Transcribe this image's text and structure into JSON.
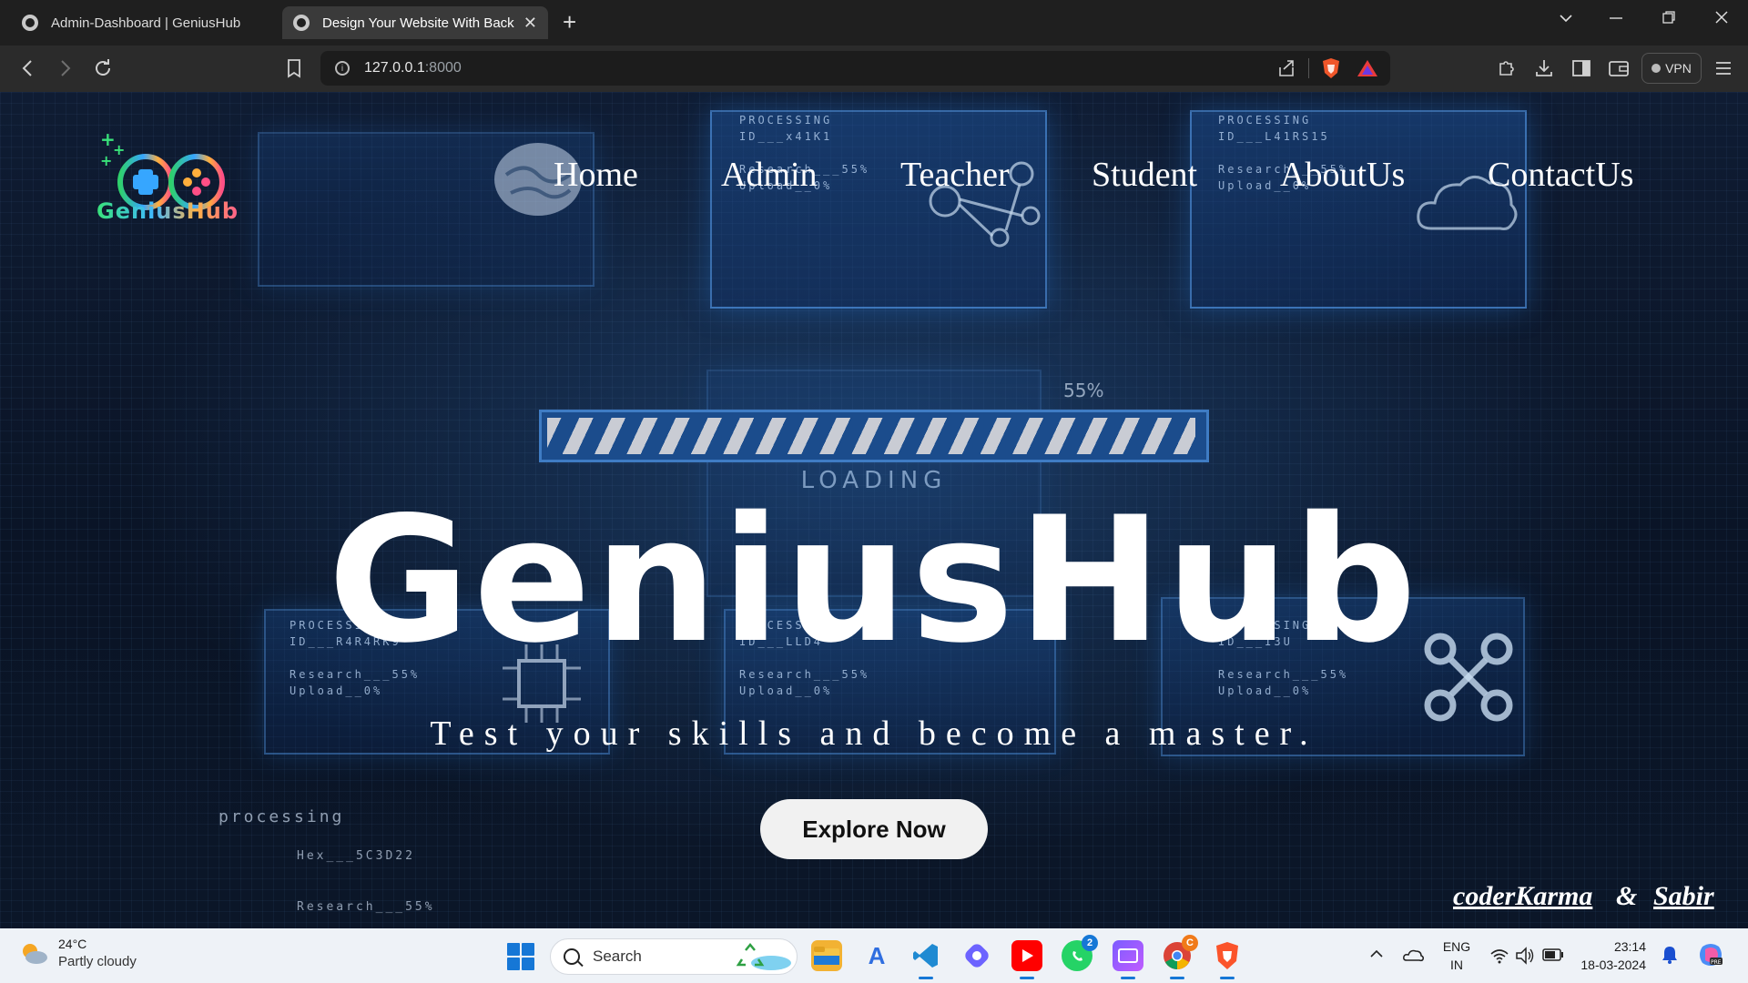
{
  "browser": {
    "tabs": [
      {
        "title": "Admin-Dashboard | GeniusHub",
        "active": false
      },
      {
        "title": "Design Your Website With Backc",
        "active": true
      }
    ],
    "new_tab_glyph": "+",
    "close_glyph": "✕",
    "url_host": "127.0.0.1",
    "url_port": ":8000",
    "vpn_label": "VPN",
    "icons": [
      "back-icon",
      "forward-icon",
      "reload-icon",
      "bookmark-icon",
      "site-info-icon",
      "share-icon",
      "brave-shields-icon",
      "brave-rewards-icon",
      "extensions-icon",
      "downloads-icon",
      "sidebar-icon",
      "wallet-icon",
      "menu-icon"
    ]
  },
  "site": {
    "logo_text": "GeniusHub",
    "nav": [
      "Home",
      "Admin",
      "Teacher",
      "Student",
      "AboutUs",
      "ContactUs"
    ],
    "hero_title": "GeniusHub",
    "tagline": "Test your skills and become a master.",
    "cta_label": "Explore Now",
    "credit_1": "coderKarma",
    "credit_amp": "&",
    "credit_2": "Sabir",
    "background": {
      "loading_label": "LOADING",
      "percent_label": "55%",
      "processing_label": "processing",
      "hex_label": "Hex___5C3D22",
      "research_label": "Research___55%",
      "panels": [
        {
          "title": "PROCESSING",
          "id": "ID___x41K1",
          "research": "Research___55%",
          "upload": "Upload__0%"
        },
        {
          "title": "PROCESSING",
          "id": "ID___L41RS15",
          "research": "Research___55%",
          "upload": "Upload__0%"
        },
        {
          "title": "PROCESSING",
          "id": "ID___R4R4RK9",
          "research": "Research___55%",
          "upload": "Upload__0%"
        },
        {
          "title": "PROCESSING",
          "id": "ID___LLD4",
          "research": "Research___55%",
          "upload": "Upload__0%"
        },
        {
          "title": "PROCESSING",
          "id": "ID___I3U",
          "research": "Research___55%",
          "upload": "Upload__0%"
        }
      ]
    },
    "colors": {
      "accent_blue": "#1b4c8c",
      "cta_bg": "#f1f1f1",
      "text": "#ffffff"
    }
  },
  "taskbar": {
    "weather_temp": "24°C",
    "weather_cond": "Partly cloudy",
    "search_placeholder": "Search",
    "whatsapp_badge": "2",
    "lang_1": "ENG",
    "lang_2": "IN",
    "time": "23:14",
    "date": "18-03-2024",
    "apps": [
      "windows-start",
      "search",
      "recycle-widget",
      "file-explorer",
      "app-store",
      "vscode",
      "copilot-app",
      "youtube",
      "whatsapp",
      "media-app",
      "chrome",
      "brave"
    ]
  }
}
